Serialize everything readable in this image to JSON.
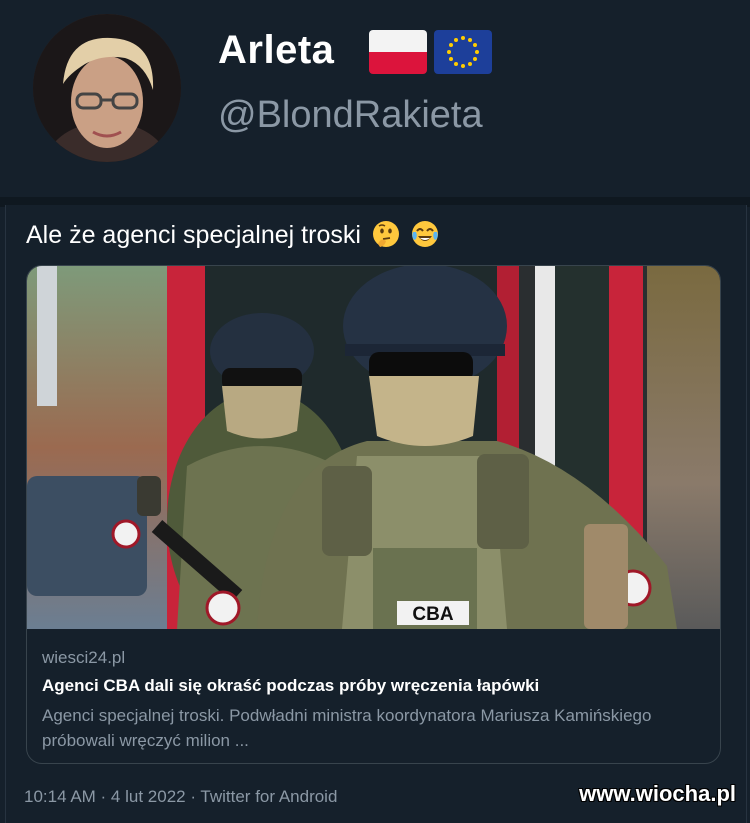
{
  "profile": {
    "display_name": "Arleta",
    "handle": "@BlondRakieta",
    "flags": [
      "poland-flag-icon",
      "eu-flag-icon"
    ]
  },
  "tweet": {
    "text": "Ale że agenci specjalnej troski",
    "emojis": [
      "thinking-face-icon",
      "tears-of-joy-icon"
    ],
    "card": {
      "domain": "wiesci24.pl",
      "title": "Agenci CBA dali się okraść podczas próby wręczenia łapówki",
      "description": "Agenci specjalnej troski. Podwładni ministra koordynatora Mariusza Kamińskiego próbowali wręczyć milion ...",
      "image_label": "CBA"
    },
    "meta": "10:14 AM · 4 lut 2022 · Twitter for Android"
  },
  "watermark": "www.wiocha.pl",
  "colors": {
    "background": "#15202b",
    "secondary_text": "#8b98a5",
    "border": "#38444d"
  }
}
